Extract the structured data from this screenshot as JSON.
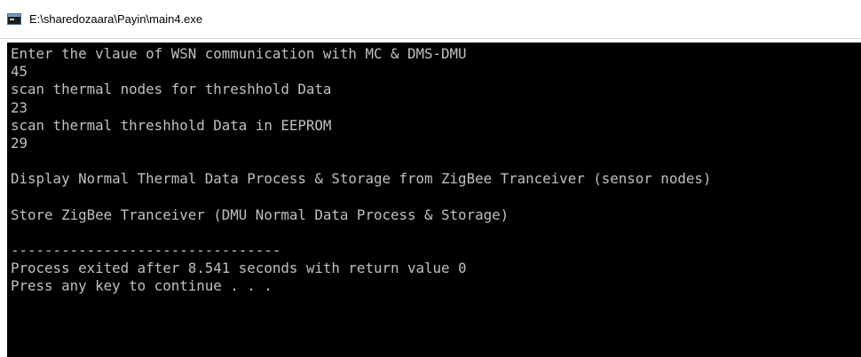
{
  "window": {
    "title": "E:\\sharedozaara\\Payin\\main4.exe",
    "icon": "console-app-icon"
  },
  "console": {
    "background": "#000000",
    "foreground": "#c0c0c0",
    "lines": [
      "Enter the vlaue of WSN communication with MC & DMS-DMU",
      "45",
      "scan thermal nodes for threshhold Data",
      "23",
      "scan thermal threshhold Data in EEPROM",
      "29",
      "",
      "Display Normal Thermal Data Process & Storage from ZigBee Tranceiver (sensor nodes)",
      "",
      "Store ZigBee Tranceiver (DMU Normal Data Process & Storage)",
      "",
      "--------------------------------",
      "Process exited after 8.541 seconds with return value 0",
      "Press any key to continue . . ."
    ]
  }
}
